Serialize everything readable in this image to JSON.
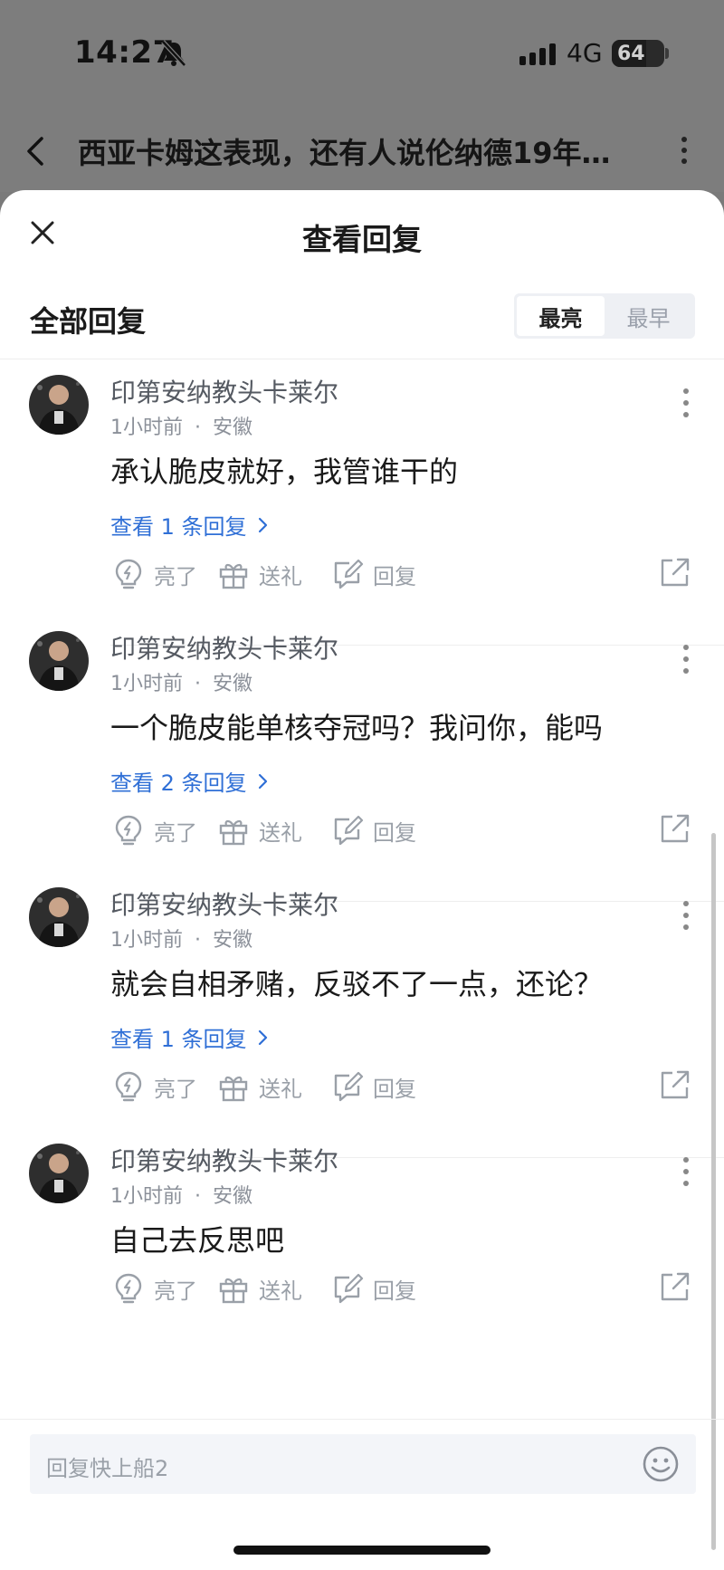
{
  "status_bar": {
    "time": "14:27",
    "network": "4G",
    "battery": "64"
  },
  "header": {
    "title": "西亚卡姆这表现，还有人说伦纳德19年…"
  },
  "sheet": {
    "title": "查看回复",
    "section_title": "全部回复",
    "sort_options": [
      "最亮",
      "最早"
    ],
    "active_sort": "最亮"
  },
  "comments": [
    {
      "username": "印第安纳教头卡莱尔",
      "time": "1小时前",
      "location": "安徽",
      "content": "承认脆皮就好，我管谁干的",
      "view_replies": "查看 1 条回复"
    },
    {
      "username": "印第安纳教头卡莱尔",
      "time": "1小时前",
      "location": "安徽",
      "content": "一个脆皮能单核夺冠吗？我问你，能吗",
      "view_replies": "查看 2 条回复"
    },
    {
      "username": "印第安纳教头卡莱尔",
      "time": "1小时前",
      "location": "安徽",
      "content": "就会自相矛赌，反驳不了一点，还论？",
      "view_replies": "查看 1 条回复"
    },
    {
      "username": "印第安纳教头卡莱尔",
      "time": "1小时前",
      "location": "安徽",
      "content": "自己去反思吧",
      "view_replies": ""
    }
  ],
  "actions": {
    "like": "亮了",
    "gift": "送礼",
    "reply": "回复"
  },
  "meta_separator": "·",
  "reply_input": {
    "placeholder": "回复快上船2"
  },
  "icons": [
    "back-icon",
    "more-icon",
    "close-icon",
    "lightbulb-icon",
    "gift-icon",
    "reply-edit-icon",
    "share-icon",
    "emoji-icon",
    "chevron-right-icon"
  ],
  "colors": {
    "link": "#2f6fd6",
    "muted": "#9aa0a8",
    "dim_overlay": "#7d7d7d"
  }
}
